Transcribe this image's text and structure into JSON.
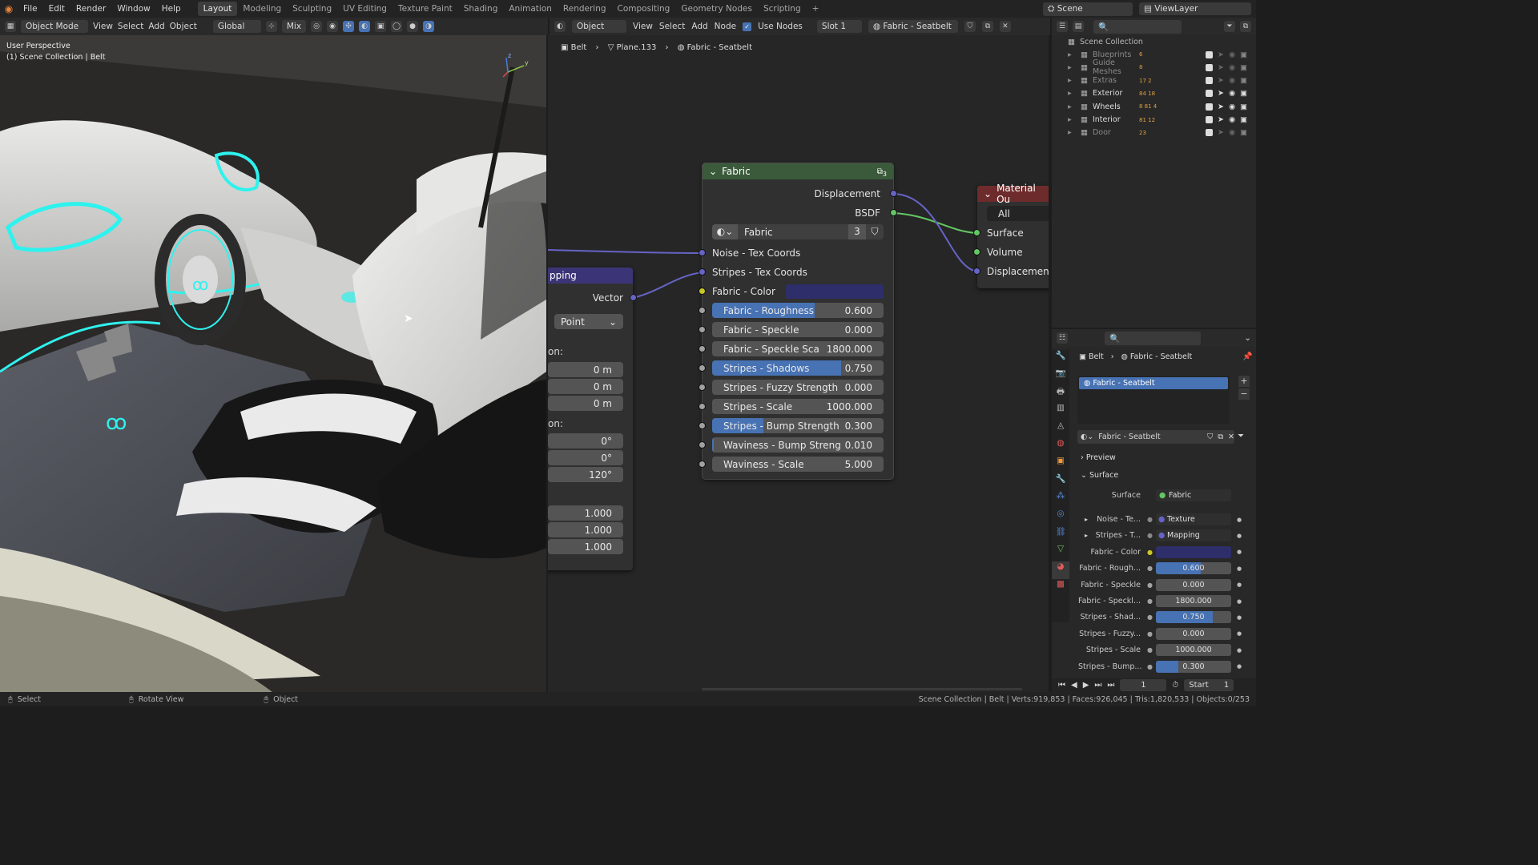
{
  "menu": [
    "File",
    "Edit",
    "Render",
    "Window",
    "Help"
  ],
  "workspaces": [
    "Layout",
    "Modeling",
    "Sculpting",
    "UV Editing",
    "Texture Paint",
    "Shading",
    "Animation",
    "Rendering",
    "Compositing",
    "Geometry Nodes",
    "Scripting"
  ],
  "scene": {
    "name": "Scene",
    "view_layer": "ViewLayer"
  },
  "viewport": {
    "mode": "Object Mode",
    "menus": [
      "View",
      "Select",
      "Add",
      "Object"
    ],
    "transform": "Global",
    "pivot": "Mix",
    "overlay_title": "User Perspective",
    "overlay_sub": "(1) Scene Collection | Belt",
    "axes": {
      "x": "x",
      "y": "y",
      "z": "z"
    }
  },
  "node_header": {
    "editor_type": "Object",
    "menus": [
      "View",
      "Select",
      "Add",
      "Node"
    ],
    "use_nodes_label": "Use Nodes",
    "slot": "Slot 1",
    "material": "Fabric - Seatbelt"
  },
  "breadcrumb": {
    "object": "Belt",
    "mesh": "Plane.133",
    "material": "Fabric - Seatbelt"
  },
  "fabric_node": {
    "title": "Fabric",
    "user_count": "3",
    "outputs": [
      "Displacement",
      "BSDF"
    ],
    "group_name": "Fabric",
    "group_users": "3",
    "inputs": [
      {
        "label": "Noise - Tex Coords",
        "kind": "socket"
      },
      {
        "label": "Stripes - Tex Coords",
        "kind": "socket"
      },
      {
        "label": "Fabric - Color",
        "kind": "color",
        "color": "#2e2e6a"
      },
      {
        "label": "Fabric - Roughness",
        "value": "0.600",
        "fraction": 0.6
      },
      {
        "label": "Fabric - Speckle",
        "value": "0.000",
        "fraction": 0
      },
      {
        "label": "Fabric - Speckle Sca",
        "value": "1800.000",
        "fraction": 0
      },
      {
        "label": "Stripes - Shadows",
        "value": "0.750",
        "fraction": 0.75
      },
      {
        "label": "Stripes - Fuzzy Strength",
        "value": "0.000",
        "fraction": 0
      },
      {
        "label": "Stripes - Scale",
        "value": "1000.000",
        "fraction": 0
      },
      {
        "label": "Stripes - Bump Strength",
        "value": "0.300",
        "fraction": 0.3
      },
      {
        "label": "Waviness - Bump Streng",
        "value": "0.010",
        "fraction": 0.01
      },
      {
        "label": "Waviness - Scale",
        "value": "5.000",
        "fraction": 0
      }
    ]
  },
  "mapping_node": {
    "title": "pping",
    "output": "Vector",
    "type": "Point",
    "loc_label": "on:",
    "loc": [
      "0 m",
      "0 m",
      "0 m"
    ],
    "rot_label": "on:",
    "rot": [
      "0°",
      "0°",
      "120°"
    ],
    "scale": [
      "1.000",
      "1.000",
      "1.000"
    ]
  },
  "material_output": {
    "title": "Material Ou",
    "target": "All",
    "inputs": [
      "Surface",
      "Volume",
      "Displacement"
    ]
  },
  "outliner": {
    "root": "Scene Collection",
    "items": [
      {
        "name": "Blueprints",
        "counts": "6"
      },
      {
        "name": "Guide Meshes",
        "counts": "8"
      },
      {
        "name": "Extras",
        "counts": "17  2"
      },
      {
        "name": "Exterior",
        "counts": "84  18"
      },
      {
        "name": "Wheels",
        "counts": "8  81  4"
      },
      {
        "name": "Interior",
        "counts": "81  12"
      },
      {
        "name": "Door",
        "counts": "23"
      }
    ]
  },
  "properties": {
    "breadcrumb_object": "Belt",
    "breadcrumb_material": "Fabric - Seatbelt",
    "slot_name": "Fabric - Seatbelt",
    "material_name": "Fabric - Seatbelt",
    "preview_label": "Preview",
    "surface_section": "Surface",
    "surface_label": "Surface",
    "surface_value": "Fabric",
    "rows": [
      {
        "label": "Noise - Te...",
        "value": "Texture Coordinate ...",
        "kind": "link"
      },
      {
        "label": "Stripes - T...",
        "value": "Mapping",
        "kind": "link"
      },
      {
        "label": "Fabric - Color",
        "value": "",
        "kind": "color"
      },
      {
        "label": "Fabric - Rough...",
        "value": "0.600",
        "fraction": 0.6
      },
      {
        "label": "Fabric - Speckle",
        "value": "0.000",
        "fraction": 0
      },
      {
        "label": "Fabric - Speckl...",
        "value": "1800.000",
        "fraction": 0
      },
      {
        "label": "Stripes - Shad...",
        "value": "0.750",
        "fraction": 0.75
      },
      {
        "label": "Stripes - Fuzzy...",
        "value": "0.000",
        "fraction": 0
      },
      {
        "label": "Stripes - Scale",
        "value": "1000.000",
        "fraction": 0
      },
      {
        "label": "Stripes - Bump...",
        "value": "0.300",
        "fraction": 0.3
      }
    ]
  },
  "timeline": {
    "frame": "1",
    "start_label": "Start",
    "start": "1"
  },
  "status": {
    "left": [
      "Select",
      "Rotate View",
      "Object"
    ],
    "right": "Scene Collection | Belt | Verts:919,853 | Faces:926,045 | Tris:1,820,533 | Objects:0/253"
  },
  "colors": {
    "accent": "#4772b3",
    "group_header": "#3b5a3b",
    "mapping_header": "#3b3577",
    "output_header": "#6e2b2b",
    "cyan": "#2ef2ee"
  }
}
